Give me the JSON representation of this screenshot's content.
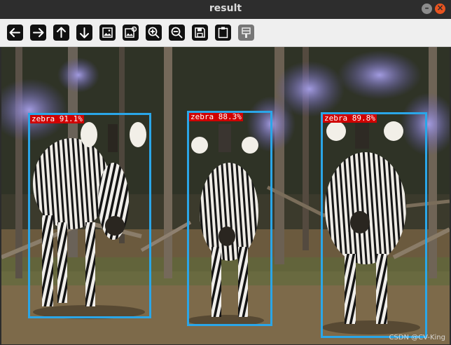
{
  "window": {
    "title": "result"
  },
  "toolbar": {
    "buttons": [
      {
        "name": "back-button",
        "icon": "arrow-left-icon"
      },
      {
        "name": "forward-button",
        "icon": "arrow-right-icon"
      },
      {
        "name": "up-button",
        "icon": "arrow-up-icon"
      },
      {
        "name": "down-button",
        "icon": "arrow-down-icon"
      },
      {
        "name": "image-button",
        "icon": "image-icon"
      },
      {
        "name": "image-settings-button",
        "icon": "image-settings-icon"
      },
      {
        "name": "zoom-in-button",
        "icon": "zoom-in-icon"
      },
      {
        "name": "zoom-out-button",
        "icon": "zoom-out-icon"
      },
      {
        "name": "save-button",
        "icon": "save-icon"
      },
      {
        "name": "clipboard-button",
        "icon": "clipboard-icon"
      },
      {
        "name": "properties-button",
        "icon": "properties-icon"
      }
    ]
  },
  "detections": [
    {
      "label": "zebra 91.1%"
    },
    {
      "label": "zebra 88.3%"
    },
    {
      "label": "zebra 89.8%"
    }
  ],
  "watermark": "CSDN @CV-King",
  "colors": {
    "box": "#2aa6e8",
    "label_bg": "#d10000"
  }
}
